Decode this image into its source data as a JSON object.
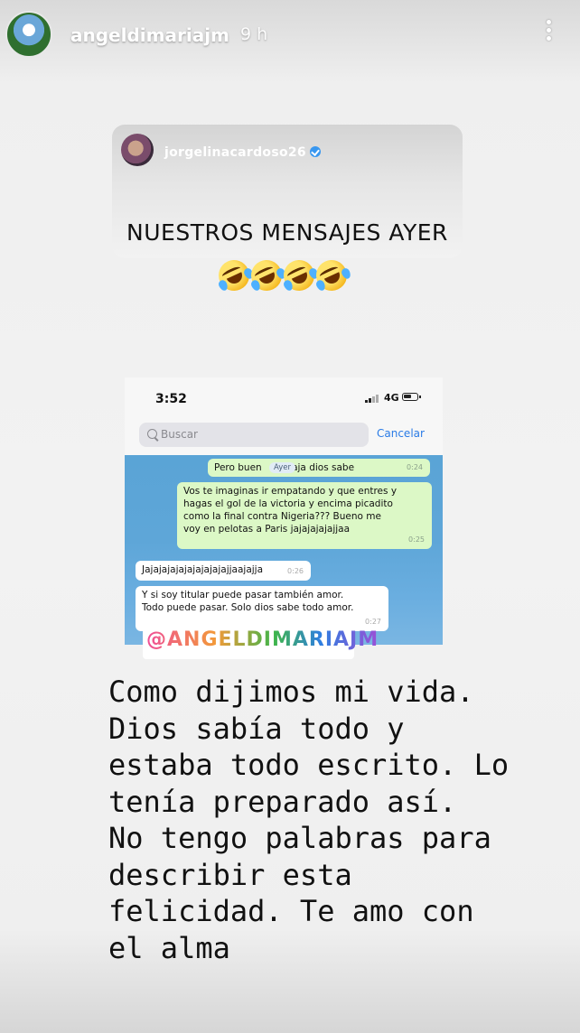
{
  "story": {
    "username": "angeldimariajm",
    "time": "9 h"
  },
  "repost": {
    "username": "jorgelinacardoso26",
    "title": "NUESTROS MENSAJES AYER",
    "emoji_count": 4
  },
  "screenshot": {
    "status_time": "3:52",
    "network": "4G",
    "search_placeholder": "Buscar",
    "cancel_label": "Cancelar",
    "day_label": "Ayer",
    "messages": [
      {
        "dir": "out",
        "text": "Pero buen          aja dios sabe",
        "time": "0:24"
      },
      {
        "dir": "out",
        "text": "Vos te imaginas ir empatando y que entres y\nhagas el gol de la victoria y encima picadito\ncomo la final contra Nigeria??? Bueno me\nvoy en pelotas a Paris jajajajajajjaa",
        "time": "0:25"
      },
      {
        "dir": "in",
        "text": "Jajajajajajajajajajajjaajajja",
        "time": "0:26"
      },
      {
        "dir": "in",
        "text": "Y si soy titular puede pasar también amor.\nTodo puede pasar. Solo dios sabe todo amor.",
        "time": "0:27"
      }
    ]
  },
  "mention_tag": "@ANGELDIMARIAJM",
  "caption": "Como dijimos mi vida.\nDios sabía todo y\nestaba todo escrito. Lo\ntenía preparado así.\nNo tengo palabras para\ndescribir esta\nfelicidad. Te amo con\nel alma",
  "colors": {
    "verified": "#3897f0",
    "outgoing_bubble": "#dcf8c6",
    "chat_bg": "#5ea6d8",
    "cancel": "#2a7be6"
  }
}
